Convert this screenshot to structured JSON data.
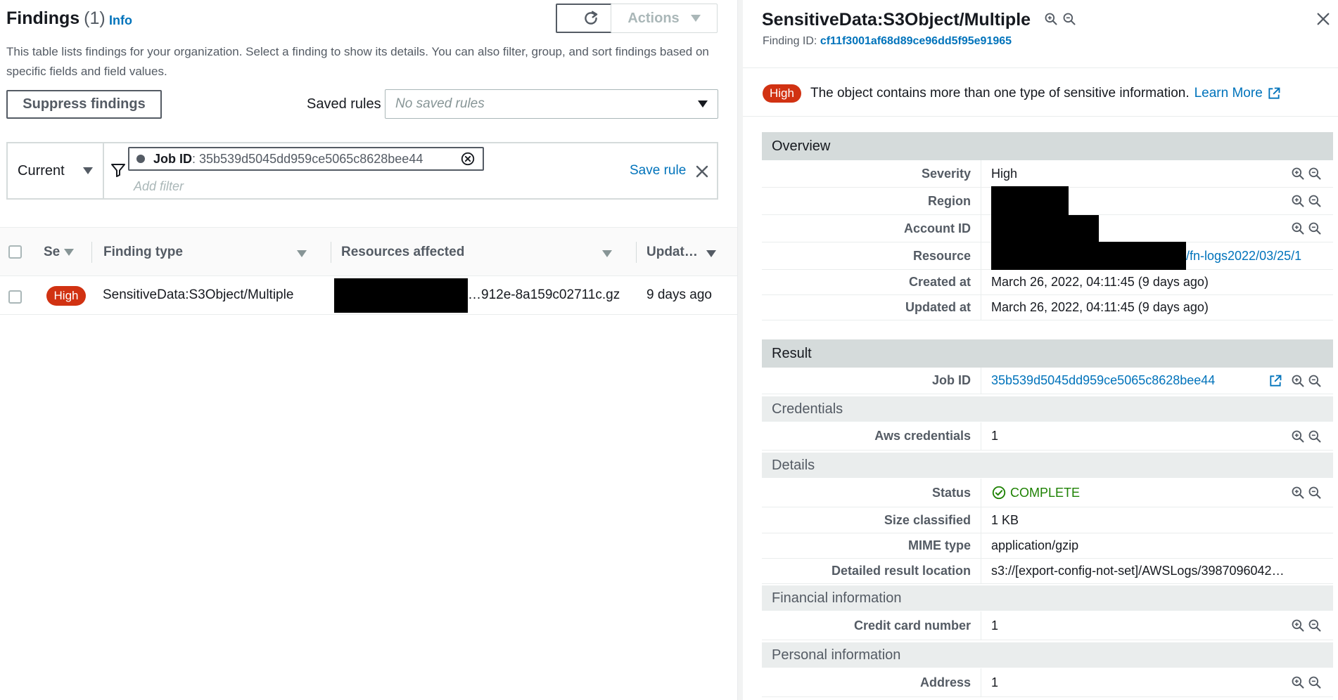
{
  "left": {
    "title": "Findings",
    "count": "(1)",
    "info": "Info",
    "actions_label": "Actions",
    "description": "This table lists findings for your organization. Select a finding to show its details. You can also filter, group, and sort findings based on specific fields and field values.",
    "suppress_label": "Suppress findings",
    "saved_rules_label": "Saved rules",
    "saved_rules_placeholder": "No saved rules",
    "filter": {
      "scope": "Current",
      "token_key": "Job ID",
      "token_value": ": 35b539d5045dd959ce5065c8628bee44",
      "add_filter_placeholder": "Add filter",
      "save_rule": "Save rule"
    },
    "table": {
      "headers": [
        "Se",
        "Finding type",
        "Resources affected",
        "Updat…"
      ],
      "rows": [
        {
          "severity": "High",
          "finding_type": "SensitiveData:S3Object/Multiple",
          "resource_suffix": "…912e-8a159c02711c.gz",
          "updated": "9 days ago"
        }
      ]
    }
  },
  "right": {
    "title": "SensitiveData:S3Object/Multiple",
    "finding_id_label": "Finding ID:",
    "finding_id": "cf11f3001af68d89ce96dd5f95e91965",
    "severity_badge": "High",
    "summary": "The object contains more than one type of sensitive information.",
    "learn_more": "Learn More",
    "overview": {
      "heading": "Overview",
      "rows": [
        {
          "key": "Severity",
          "value": "High"
        },
        {
          "key": "Region",
          "value": ""
        },
        {
          "key": "Account ID",
          "value": ""
        },
        {
          "key": "Resource",
          "value": "/fn-logs2022/03/25/1"
        },
        {
          "key": "Created at",
          "value": "March 26, 2022, 04:11:45 (9 days ago)"
        },
        {
          "key": "Updated at",
          "value": "March 26, 2022, 04:11:45 (9 days ago)"
        }
      ]
    },
    "result": {
      "heading": "Result",
      "job_id_key": "Job ID",
      "job_id_value": "35b539d5045dd959ce5065c8628bee44",
      "credentials_heading": "Credentials",
      "aws_credentials_key": "Aws credentials",
      "aws_credentials_value": "1",
      "details_heading": "Details",
      "status_key": "Status",
      "status_value": "COMPLETE",
      "size_key": "Size classified",
      "size_value": "1 KB",
      "mime_key": "MIME type",
      "mime_value": "application/gzip",
      "location_key": "Detailed result location",
      "location_value": "s3://[export-config-not-set]/AWSLogs/3987096042…",
      "financial_heading": "Financial information",
      "credit_card_key": "Credit card number",
      "credit_card_value": "1",
      "personal_heading": "Personal information",
      "address_key": "Address",
      "address_value": "1"
    }
  },
  "colors": {
    "link": "#0073bb",
    "severity_high": "#d13212",
    "status_ok": "#1d8102",
    "section_header": "#d5dbdb",
    "subsection_header": "#eaeded"
  },
  "icons": [
    "refresh-icon",
    "caret-down-icon",
    "filter-icon",
    "remove-token-icon",
    "close-icon",
    "zoom-in-icon",
    "zoom-out-icon",
    "external-link-icon",
    "check-circle-icon"
  ]
}
